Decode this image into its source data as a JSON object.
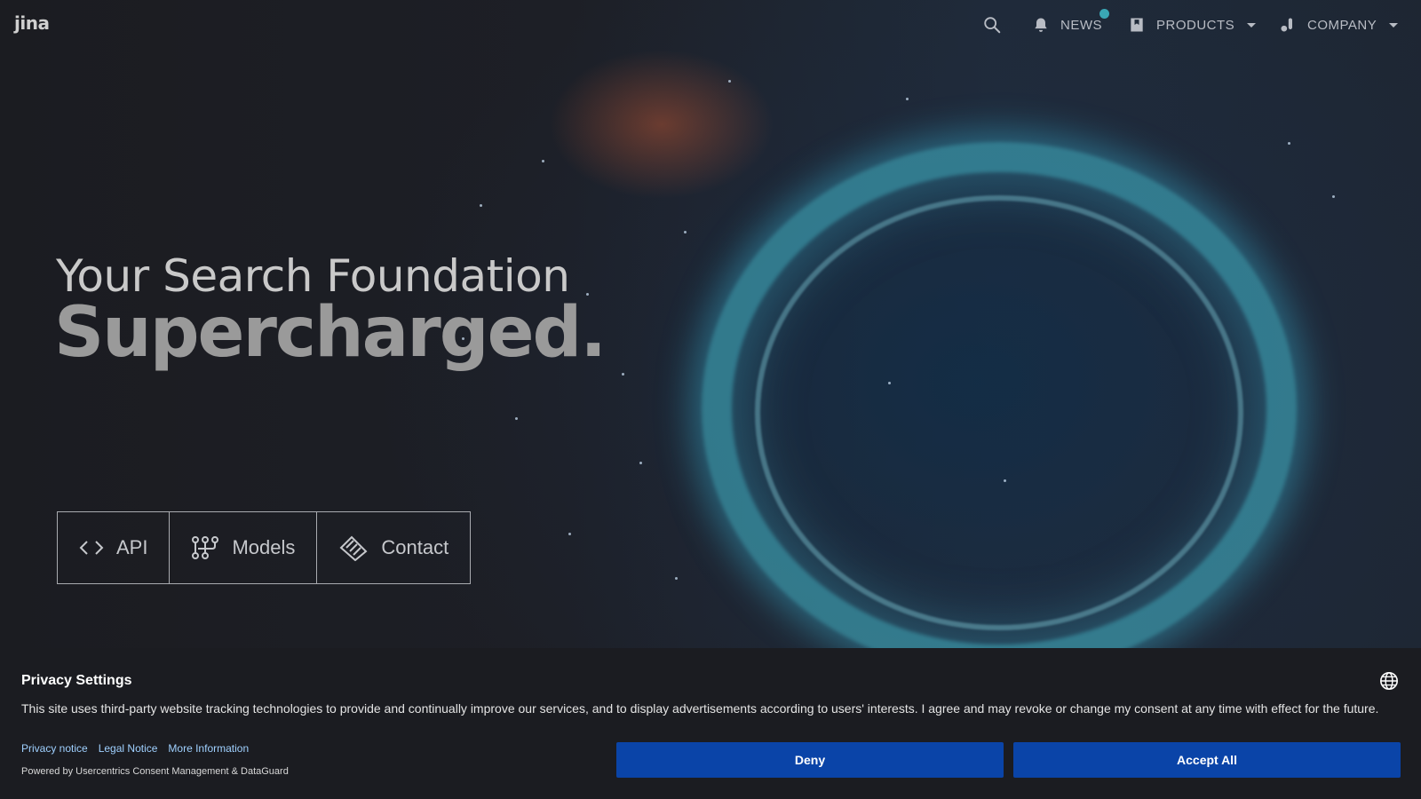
{
  "nav": {
    "logo": "jina",
    "news_label": "NEWS",
    "products_label": "PRODUCTS",
    "company_label": "COMPANY"
  },
  "hero": {
    "line1": "Your Search Foundation",
    "line2": "Supercharged.",
    "buttons": [
      {
        "label": "API",
        "icon": "code-brackets-icon"
      },
      {
        "label": "Models",
        "icon": "models-graph-icon"
      },
      {
        "label": "Contact",
        "icon": "handshake-icon"
      }
    ]
  },
  "consent": {
    "title": "Privacy Settings",
    "body": "This site uses third-party website tracking technologies to provide and continually improve our services, and to display advertisements according to users' interests. I agree and may revoke or change my consent at any time with effect for the future.",
    "links": [
      "Privacy notice",
      "Legal Notice",
      "More Information"
    ],
    "powered": "Powered by Usercentrics Consent Management & DataGuard",
    "deny_label": "Deny",
    "accept_label": "Accept All"
  },
  "colors": {
    "accent_button": "#0a44a8",
    "notification_dot": "#3aa7b5",
    "link": "#9fd0ff"
  }
}
